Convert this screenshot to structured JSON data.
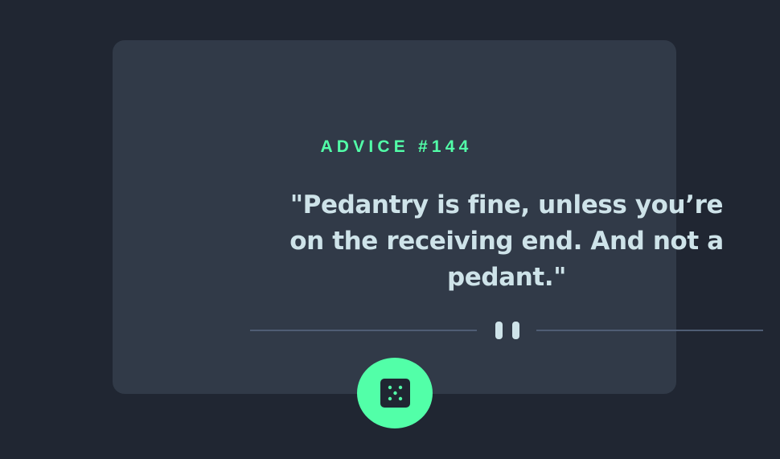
{
  "advice": {
    "label": "ADVICE #144",
    "quote": "\"Pedantry is fine, unless you’re on the receiving end. And not a pedant.\""
  },
  "icons": {
    "divider": "pause-icon",
    "button": "dice-icon"
  },
  "colors": {
    "background": "#202632",
    "card": "#313a48",
    "accent": "#52ffa8",
    "quote_text": "#cee3e9",
    "divider_line": "#4f5d74"
  }
}
